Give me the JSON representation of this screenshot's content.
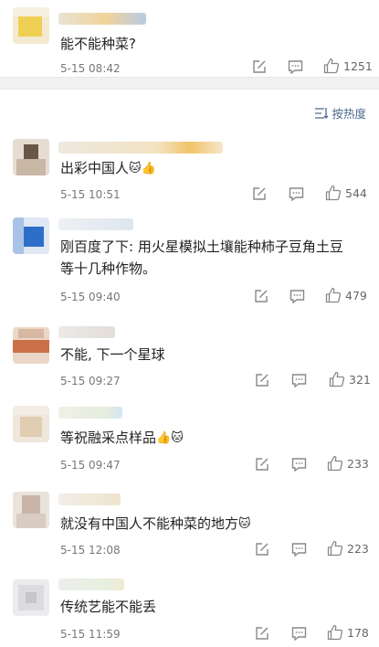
{
  "sort_label": "按热度",
  "comments": [
    {
      "text": "能不能种菜?",
      "emoji": "",
      "time": "5-15 08:42",
      "likes": "1251"
    },
    {
      "text": "出彩中国人",
      "emoji": "🐱👍",
      "time": "5-15 10:51",
      "likes": "544"
    },
    {
      "text": "刚百度了下: 用火星模拟土壤能种柿子豆角土豆\n等十几种作物。",
      "emoji": "",
      "time": "5-15 09:40",
      "likes": "479"
    },
    {
      "text": "不能, 下一个星球",
      "emoji": "",
      "time": "5-15 09:27",
      "likes": "321"
    },
    {
      "text": "等祝融采点样品",
      "emoji": "👍🐱",
      "time": "5-15 09:47",
      "likes": "233"
    },
    {
      "text": "就没有中国人不能种菜的地方",
      "emoji": "🐱",
      "time": "5-15 12:08",
      "likes": "223"
    },
    {
      "text": "传统艺能不能丢",
      "emoji": "",
      "time": "5-15 11:59",
      "likes": "178"
    }
  ]
}
